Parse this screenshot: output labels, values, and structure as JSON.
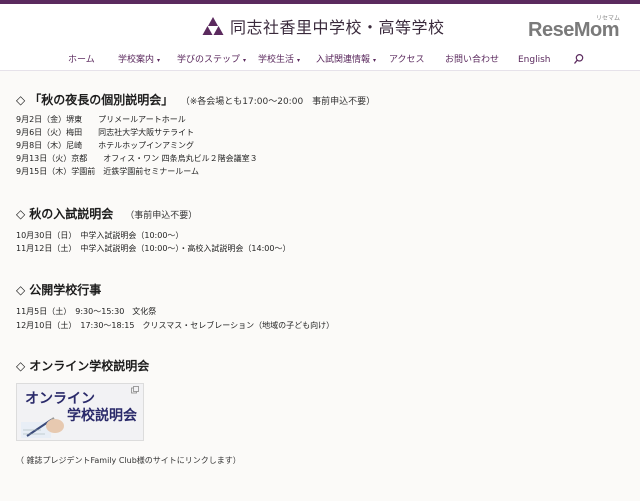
{
  "header": {
    "school_name": "同志社香里中学校・高等学校",
    "resemom_ruby": "リセマム",
    "resemom_logo": "ReseMom"
  },
  "nav": {
    "items": [
      {
        "label": "ホーム",
        "dropdown": false
      },
      {
        "label": "学校案内",
        "dropdown": true
      },
      {
        "label": "学びのステップ",
        "dropdown": true
      },
      {
        "label": "学校生活",
        "dropdown": true
      },
      {
        "label": "入試関連情報",
        "dropdown": true
      },
      {
        "label": "アクセス",
        "dropdown": false
      },
      {
        "label": "お問い合わせ",
        "dropdown": false
      },
      {
        "label": "English",
        "dropdown": false
      }
    ],
    "caret": "▾"
  },
  "sections": {
    "autumn_individual": {
      "diamond": "◇",
      "title": "「秋の夜長の個別説明会」",
      "note": "（※各会場とも17:00～20:00　事前申込不要）",
      "lines": [
        "9月2日（金）堺東　　プリメールアートホール",
        "9月6日（火）梅田　　同志社大学大阪サテライト",
        "9月8日（木）尼崎　　ホテルホップインアミング",
        "9月13日（火）京都　　オフィス・ワン 四条烏丸ビル２階会議室３",
        "9月15日（木）学園前　近鉄学園前セミナールーム"
      ]
    },
    "autumn_entrance": {
      "diamond": "◇",
      "title": "秋の入試説明会",
      "note": "（事前申込不要）",
      "lines": [
        "10月30日（日）　中学入試説明会（10:00～）",
        "11月12日（土）　中学入試説明会（10:00～）・高校入試説明会（14:00～）"
      ]
    },
    "public_events": {
      "diamond": "◇",
      "title": "公開学校行事",
      "lines": [
        "11月5日（土）　9:30～15:30　文化祭",
        "12月10日（土）　17:30～18:15　クリスマス・セレブレーション（地域の子ども向け）"
      ]
    },
    "online": {
      "diamond": "◇",
      "title": "オンライン学校説明会",
      "banner_line1": "オンライン",
      "banner_line2": "学校説明会",
      "credit": "（ 雑誌プレジデントFamily Club様のサイトにリンクします）"
    }
  },
  "colors": {
    "brand_purple": "#5b2a5e",
    "background": "#fbfaf8",
    "banner_text": "#2a2a6a"
  },
  "icons": [
    "school-crest-icon",
    "search-icon",
    "external-link-icon",
    "pen-hand-icon"
  ]
}
